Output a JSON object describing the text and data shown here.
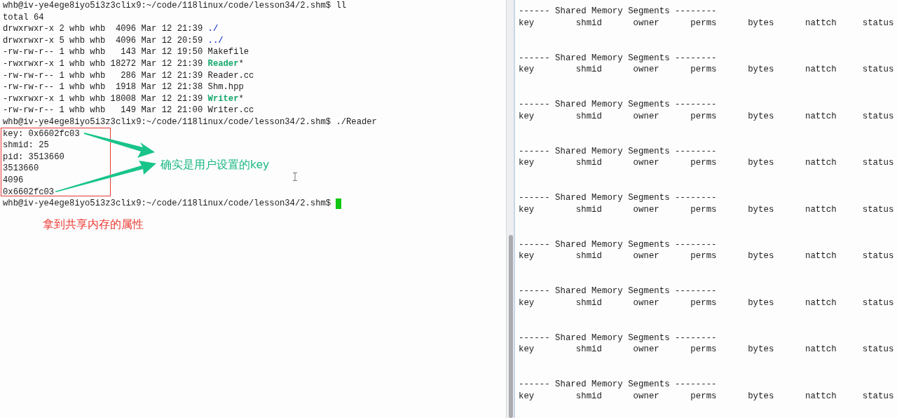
{
  "left_terminal": {
    "lines": [
      {
        "kind": "prompt",
        "prompt": "whb@iv-ye4ege8iyo5i3z3clix9:~/code/118linux/code/lesson34/2.shm$ ",
        "command": "ll",
        "cursor": false
      },
      {
        "kind": "text",
        "text": "total 64"
      },
      {
        "kind": "ls",
        "text": "drwxrwxr-x 2 whb whb  4096 Mar 12 21:39 ",
        "name": "./",
        "color": "#2947d6"
      },
      {
        "kind": "ls",
        "text": "drwxrwxr-x 5 whb whb  4096 Mar 12 20:59 ",
        "name": "../",
        "color": "#2947d6"
      },
      {
        "kind": "ls",
        "text": "-rw-rw-r-- 1 whb whb   143 Mar 12 19:50 ",
        "name": "Makefile",
        "color": "#1c1c1c"
      },
      {
        "kind": "ls",
        "text": "-rwxrwxr-x 1 whb whb 18272 Mar 12 21:39 ",
        "name": "Reader",
        "color": "#14a86b",
        "suffix": "*"
      },
      {
        "kind": "ls",
        "text": "-rw-rw-r-- 1 whb whb   286 Mar 12 21:39 ",
        "name": "Reader.cc",
        "color": "#1c1c1c"
      },
      {
        "kind": "ls",
        "text": "-rw-rw-r-- 1 whb whb  1918 Mar 12 21:38 ",
        "name": "Shm.hpp",
        "color": "#1c1c1c"
      },
      {
        "kind": "ls",
        "text": "-rwxrwxr-x 1 whb whb 18008 Mar 12 21:39 ",
        "name": "Writer",
        "color": "#14a86b",
        "suffix": "*"
      },
      {
        "kind": "ls",
        "text": "-rw-rw-r-- 1 whb whb   149 Mar 12 21:00 ",
        "name": "Writer.cc",
        "color": "#1c1c1c"
      },
      {
        "kind": "prompt",
        "prompt": "whb@iv-ye4ege8iyo5i3z3clix9:~/code/118linux/code/lesson34/2.shm$ ",
        "command": "./Reader",
        "cursor": false
      },
      {
        "kind": "text",
        "text": "key: 0x6602fc03"
      },
      {
        "kind": "text",
        "text": "shmid: 25"
      },
      {
        "kind": "text",
        "text": "pid: 3513660"
      },
      {
        "kind": "text",
        "text": "3513660"
      },
      {
        "kind": "text",
        "text": "4096"
      },
      {
        "kind": "text",
        "text": "0x6602fc03"
      },
      {
        "kind": "prompt",
        "prompt": "whb@iv-ye4ege8iyo5i3z3clix9:~/code/118linux/code/lesson34/2.shm$ ",
        "cursor": true
      }
    ]
  },
  "annotations": {
    "green_note": "确实是用户设置的key",
    "red_note": "拿到共享内存的属性"
  },
  "right_terminal": {
    "blocks": [
      {
        "header": "------ Shared Memory Segments --------",
        "columns": "key        shmid      owner      perms      bytes      nattch     status"
      },
      {
        "header": "------ Shared Memory Segments --------",
        "columns": "key        shmid      owner      perms      bytes      nattch     status"
      },
      {
        "header": "------ Shared Memory Segments --------",
        "columns": "key        shmid      owner      perms      bytes      nattch     status"
      },
      {
        "header": "------ Shared Memory Segments --------",
        "columns": "key        shmid      owner      perms      bytes      nattch     status"
      },
      {
        "header": "------ Shared Memory Segments --------",
        "columns": "key        shmid      owner      perms      bytes      nattch     status"
      },
      {
        "header": "------ Shared Memory Segments --------",
        "columns": "key        shmid      owner      perms      bytes      nattch     status"
      },
      {
        "header": "------ Shared Memory Segments --------",
        "columns": "key        shmid      owner      perms      bytes      nattch     status"
      },
      {
        "header": "------ Shared Memory Segments --------",
        "columns": "key        shmid      owner      perms      bytes      nattch     status"
      },
      {
        "header": "------ Shared Memory Segments --------",
        "columns": "key        shmid      owner      perms      bytes      nattch     status"
      }
    ]
  }
}
